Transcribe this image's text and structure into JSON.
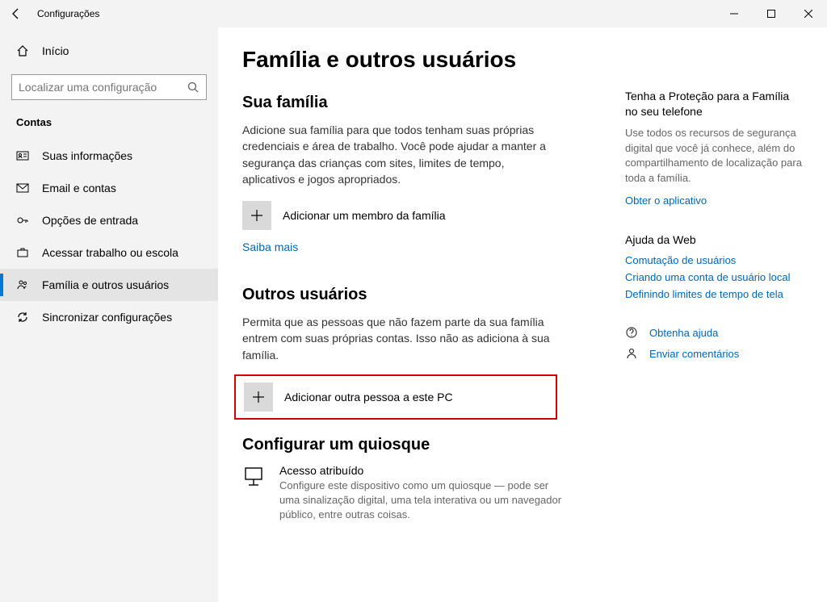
{
  "titlebar": {
    "title": "Configurações"
  },
  "sidebar": {
    "home": "Início",
    "search_placeholder": "Localizar uma configuração",
    "group": "Contas",
    "items": [
      {
        "label": "Suas informações"
      },
      {
        "label": "Email e contas"
      },
      {
        "label": "Opções de entrada"
      },
      {
        "label": "Acessar trabalho ou escola"
      },
      {
        "label": "Família e outros usuários"
      },
      {
        "label": "Sincronizar configurações"
      }
    ]
  },
  "main": {
    "title": "Família e outros usuários",
    "family_heading": "Sua família",
    "family_desc": "Adicione sua família para que todos tenham suas próprias credenciais e área de trabalho. Você pode ajudar a manter a segurança das crianças com sites, limites de tempo, aplicativos e jogos apropriados.",
    "add_family": "Adicionar um membro da família",
    "learn_more": "Saiba mais",
    "others_heading": "Outros usuários",
    "others_desc": "Permita que as pessoas que não fazem parte da sua família entrem com suas próprias contas. Isso não as adiciona à sua família.",
    "add_other": "Adicionar outra pessoa a este PC",
    "kiosk_heading": "Configurar um quiosque",
    "kiosk_title": "Acesso atribuído",
    "kiosk_desc": "Configure este dispositivo como um quiosque — pode ser uma sinalização digital, uma tela interativa ou um navegador público, entre outras coisas."
  },
  "right": {
    "protection_heading": "Tenha a Proteção para a Família no seu telefone",
    "protection_desc": "Use todos os recursos de segurança digital que você já conhece, além do compartilhamento de localização para toda a família.",
    "get_app": "Obter o aplicativo",
    "webhelp_heading": "Ajuda da Web",
    "links": [
      "Comutação de usuários",
      "Criando uma conta de usuário local",
      "Definindo limites de tempo de tela"
    ],
    "get_help": "Obtenha ajuda",
    "feedback": "Enviar comentários"
  }
}
